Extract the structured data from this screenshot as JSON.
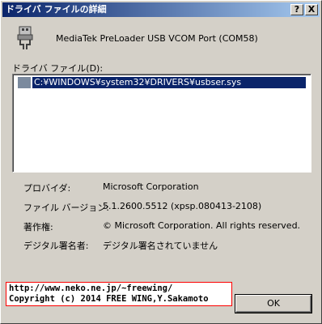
{
  "window": {
    "title": "ドライバ ファイルの詳細",
    "help_button": "?",
    "close_button": "X"
  },
  "device": {
    "name": "MediaTek PreLoader USB VCOM Port (COM58)"
  },
  "driver_files": {
    "label": "ドライバ ファイル(D):",
    "items": [
      "C:¥WINDOWS¥system32¥DRIVERS¥usbser.sys"
    ]
  },
  "details": {
    "provider_label": "プロバイダ:",
    "provider_value": "Microsoft Corporation",
    "version_label": "ファイル バージョン:",
    "version_value": "5.1.2600.5512 (xpsp.080413-2108)",
    "copyright_label": "著作権:",
    "copyright_value": "© Microsoft Corporation. All rights reserved.",
    "signer_label": "デジタル署名者:",
    "signer_value": "デジタル署名されていません"
  },
  "credit": {
    "line1": "http://www.neko.ne.jp/~freewing/",
    "line2": "Copyright (c) 2014 FREE WING,Y.Sakamoto"
  },
  "buttons": {
    "ok": "OK"
  }
}
